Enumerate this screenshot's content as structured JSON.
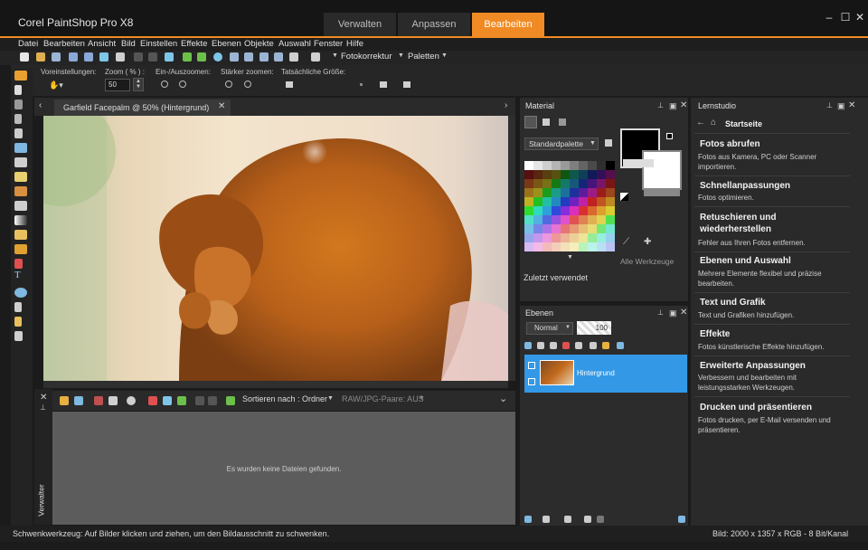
{
  "app": {
    "title": "Corel PaintShop Pro X8"
  },
  "modes": {
    "tab1": "Verwalten",
    "tab2": "Anpassen",
    "tab3": "Bearbeiten"
  },
  "window": {
    "minimize": "‒",
    "maximize": "☐",
    "close": "✕"
  },
  "menu": [
    "Datei",
    "Bearbeiten",
    "Ansicht",
    "Bild",
    "Einstellen",
    "Effekte",
    "Ebenen",
    "Objekte",
    "Auswahl",
    "Fenster",
    "Hilfe"
  ],
  "toolbar": {
    "fotokorrektur": "Fotokorrektur",
    "paletten": "Paletten"
  },
  "options": {
    "presets_label": "Voreinstellungen:",
    "zoom_label": "Zoom ( % ) :",
    "zoom_value": "50",
    "zoom_inout_label": "Ein-/Auszoomen:",
    "zoom_more_label": "Stärker zoomen:",
    "actual_size_label": "Tatsächliche Größe:"
  },
  "document": {
    "tab_title": "Garfield Facepalm @  50% (Hintergrund)"
  },
  "organizer": {
    "sort_label": "Sortieren nach :",
    "sort_value": "Ordner",
    "raw_pairs": "RAW/JPG-Paare: AUS",
    "empty_message": "Es wurden keine Dateien gefunden.",
    "side_label": "Verwalter"
  },
  "material": {
    "title": "Material",
    "palette": "Standardpalette",
    "all_tools": "Alle Werkzeuge",
    "recent": "Zuletzt verwendet"
  },
  "layers": {
    "title": "Ebenen",
    "blend_mode": "Normal",
    "opacity": "100",
    "layer_name": "Hintergrund"
  },
  "learning": {
    "title": "Lernstudio",
    "home": "Startseite",
    "items": [
      {
        "title": "Fotos abrufen",
        "desc": "Fotos aus Kamera, PC oder Scanner importieren."
      },
      {
        "title": "Schnellanpassungen",
        "desc": "Fotos optimieren."
      },
      {
        "title": "Retuschieren und wiederherstellen",
        "desc": "Fehler aus Ihren Fotos entfernen."
      },
      {
        "title": "Ebenen und Auswahl",
        "desc": "Mehrere Elemente flexibel und präzise bearbeiten."
      },
      {
        "title": "Text und Grafik",
        "desc": "Text und Grafiken hinzufügen."
      },
      {
        "title": "Effekte",
        "desc": "Fotos künstlerische Effekte hinzufügen."
      },
      {
        "title": "Erweiterte Anpassungen",
        "desc": "Verbessern und bearbeiten mit leistungsstarken Werkzeugen."
      },
      {
        "title": "Drucken und präsentieren",
        "desc": "Fotos drucken, per E-Mail versenden und präsentieren."
      }
    ]
  },
  "status": {
    "left": "Schwenkwerkzeug: Auf Bilder klicken und ziehen, um den Bildausschnitt zu schwenken.",
    "right": "Bild:  2000 x 1357 x RGB - 8 Bit/Kanal"
  },
  "colors": {
    "accent": "#f08a24",
    "selection": "#3399e6"
  }
}
